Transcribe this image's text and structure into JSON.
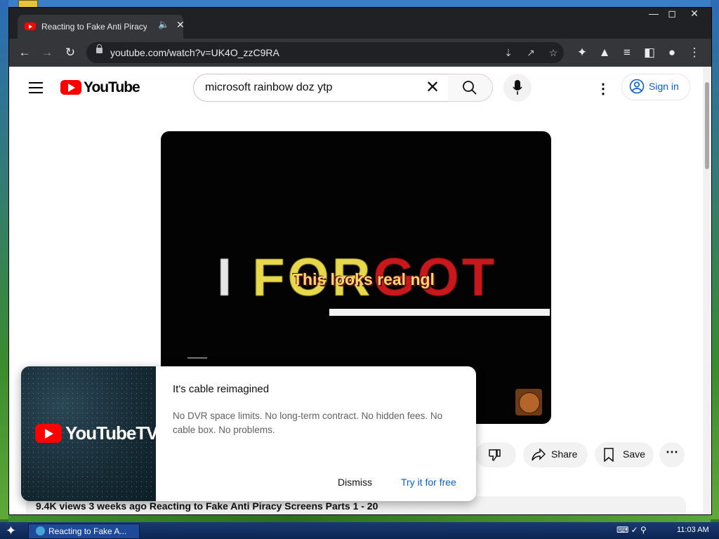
{
  "browser": {
    "tab_title": "Reacting to Fake Anti Piracy Sc",
    "tab_audio_icon": "speaker-icon",
    "url": "youtube.com/watch?v=UK4O_zzC9RA"
  },
  "youtube": {
    "logo_text": "YouTube",
    "search_value": "microsoft rainbow doz ytp",
    "sign_in_label": "Sign in"
  },
  "video": {
    "frame_text_white": "I ",
    "frame_text_yellow": "FOR",
    "frame_text_red": "GOT",
    "caption": "This looks real ngl"
  },
  "actions": {
    "share_label": "Share",
    "save_label": "Save"
  },
  "description": {
    "text": "9.4K views  3 weeks ago  Reacting to Fake Anti Piracy Screens Parts 1 - 20"
  },
  "promo": {
    "logo_text": "YouTubeTV",
    "title": "It's cable reimagined",
    "body": "No DVR space limits. No long-term contract. No hidden fees. No cable box. No problems.",
    "dismiss_label": "Dismiss",
    "try_label": "Try it for free"
  },
  "taskbar": {
    "task_label": "Reacting to Fake A...",
    "clock": "11:03 AM"
  },
  "colors": {
    "accent_blue": "#065fd4",
    "youtube_red": "#ff0000"
  }
}
